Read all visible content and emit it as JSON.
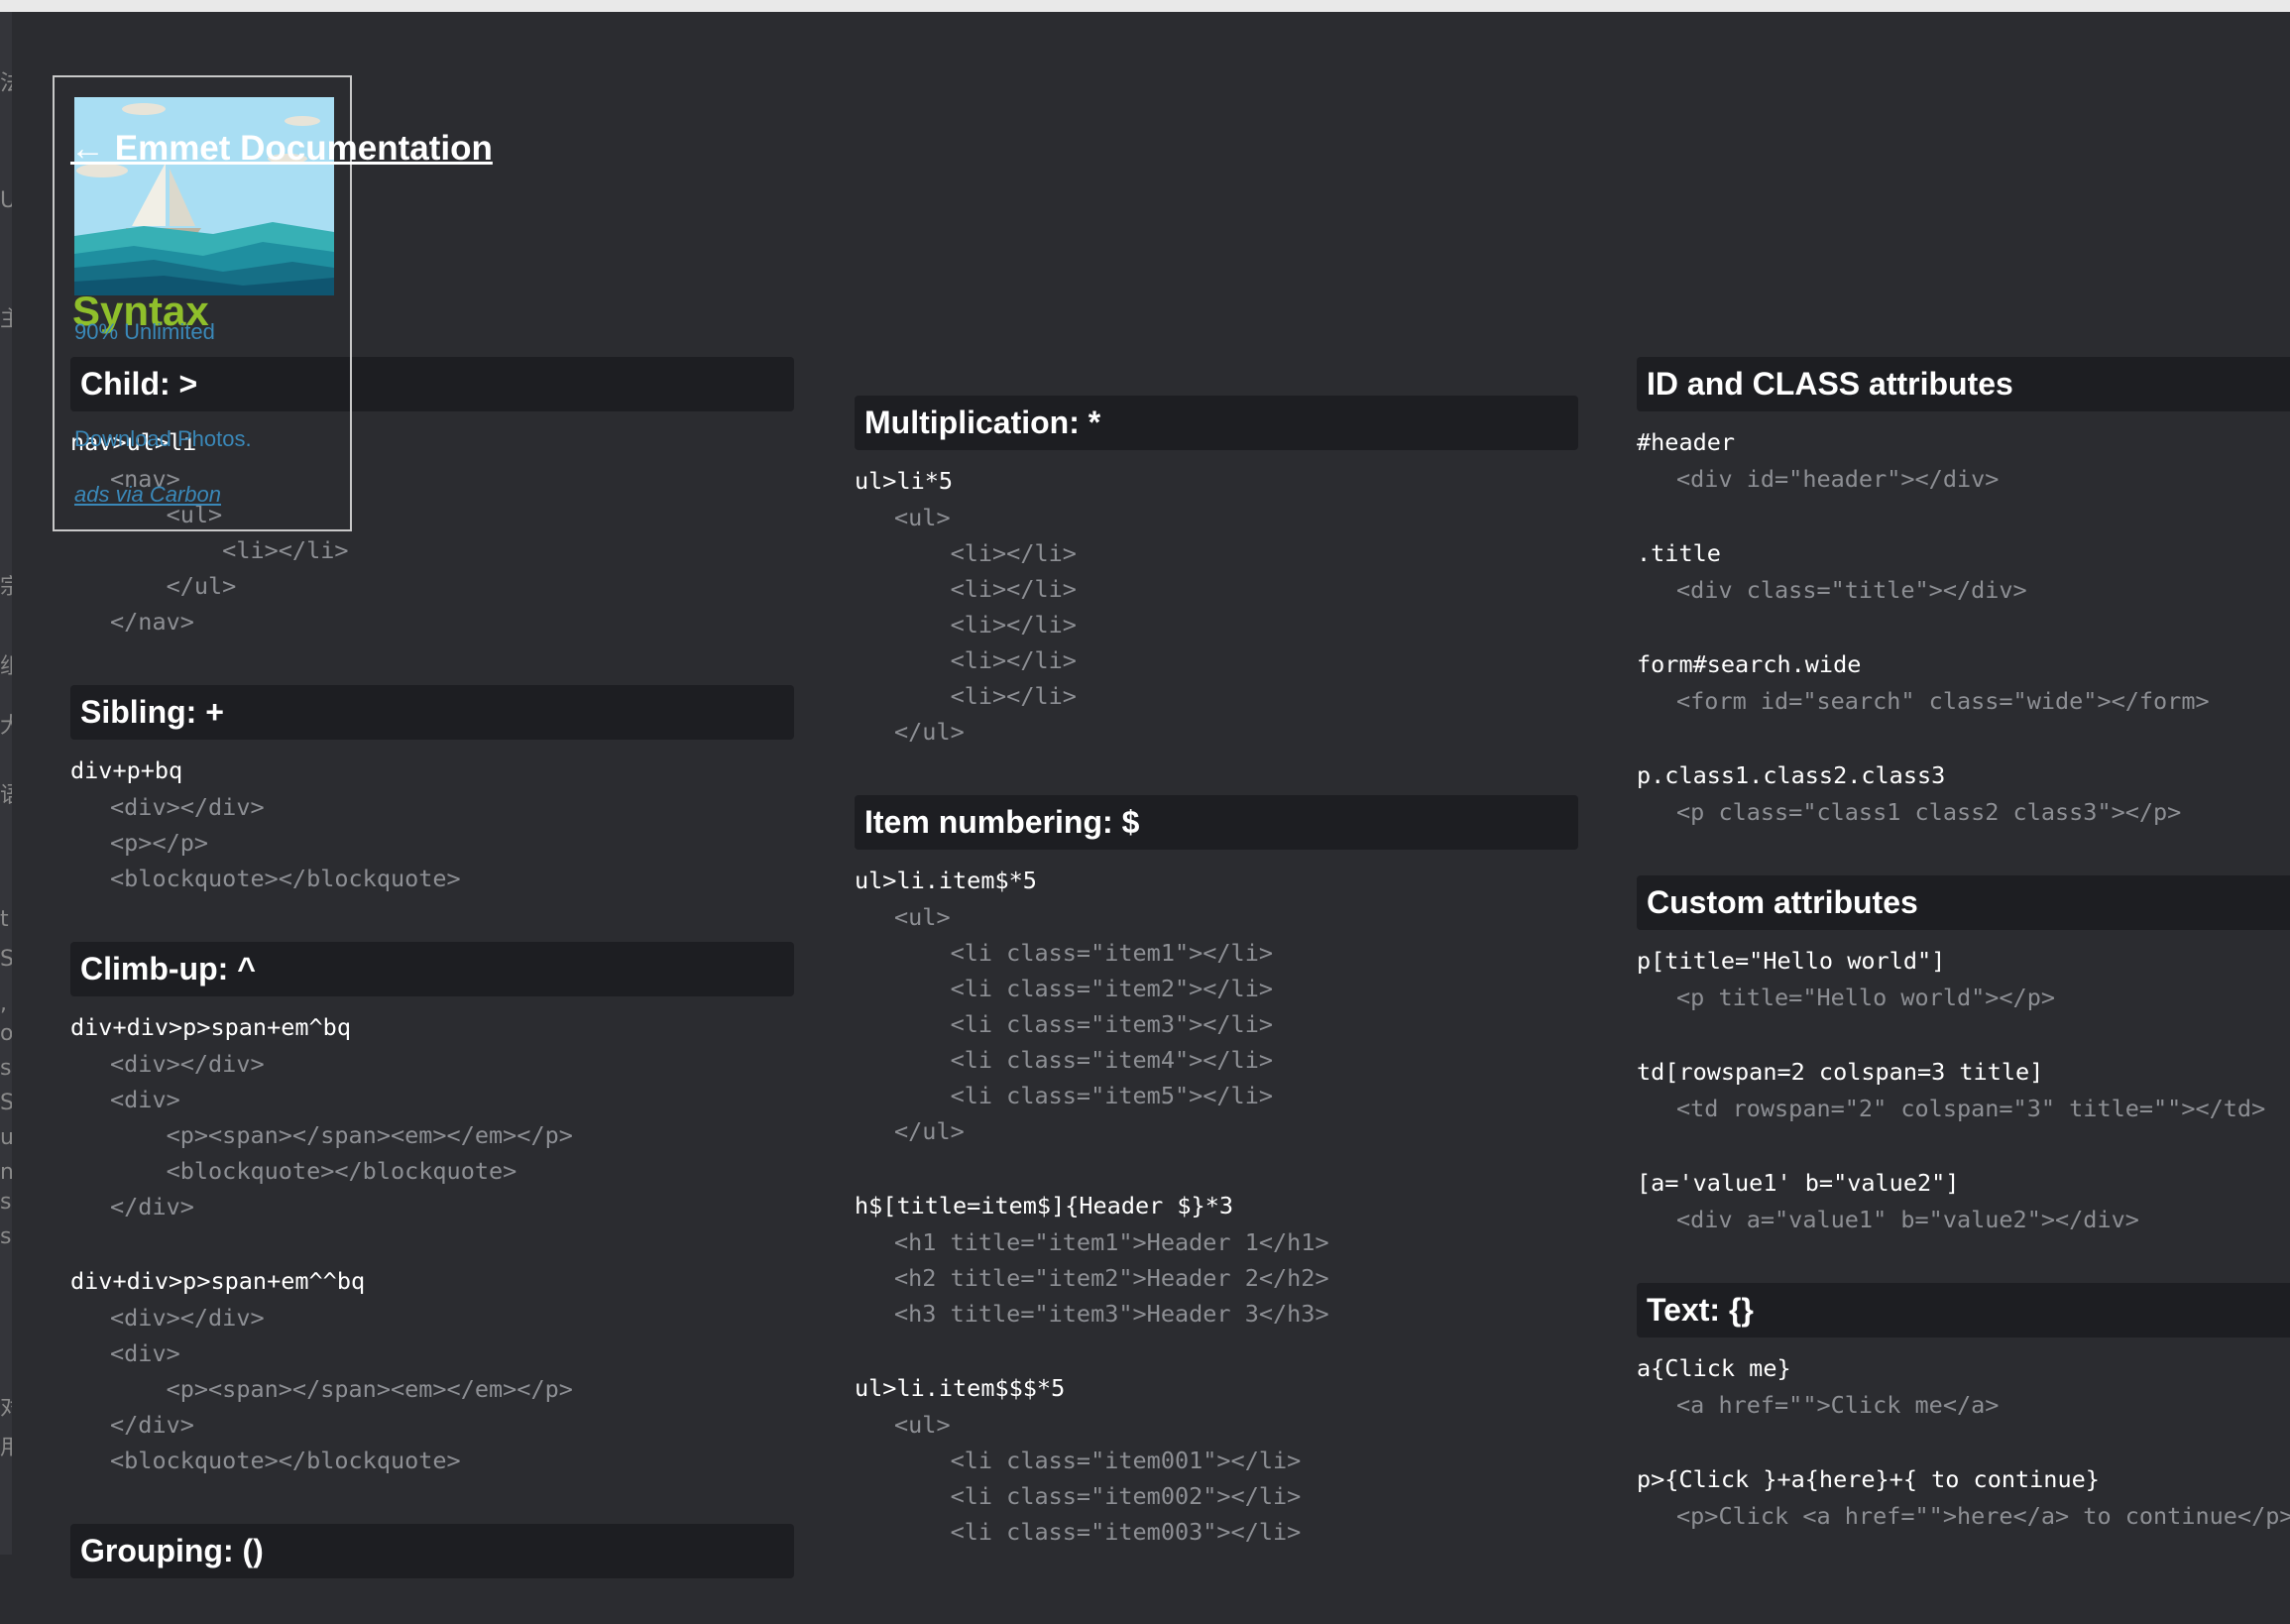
{
  "back_link": "← Emmet Documentation",
  "ad": {
    "title": "Syntax",
    "subtitle": "90% Unlimited",
    "text": "Download Photos.",
    "via": "ads via Carbon"
  },
  "left_gutter_glyphs": [
    "法",
    "U",
    "主",
    "宗",
    "组",
    "大",
    "语",
    "t",
    "S",
    ",",
    "ol",
    "s",
    "S",
    "u",
    "ng",
    "s",
    "si",
    "对",
    "用"
  ],
  "columns": [
    [
      {
        "title": "Child: >",
        "examples": [
          {
            "abbr": "nav>ul>li",
            "output": [
              "<nav>",
              "    <ul>",
              "        <li></li>",
              "    </ul>",
              "</nav>"
            ]
          }
        ]
      },
      {
        "title": "Sibling: +",
        "examples": [
          {
            "abbr": "div+p+bq",
            "output": [
              "<div></div>",
              "<p></p>",
              "<blockquote></blockquote>"
            ]
          }
        ]
      },
      {
        "title": "Climb-up: ^",
        "examples": [
          {
            "abbr": "div+div>p>span+em^bq",
            "output": [
              "<div></div>",
              "<div>",
              "    <p><span></span><em></em></p>",
              "    <blockquote></blockquote>",
              "</div>"
            ]
          },
          {
            "abbr": "div+div>p>span+em^^bq",
            "output": [
              "<div></div>",
              "<div>",
              "    <p><span></span><em></em></p>",
              "</div>",
              "<blockquote></blockquote>"
            ]
          }
        ]
      },
      {
        "title": "Grouping: ()",
        "examples": []
      }
    ],
    [
      {
        "title": "Multiplication: *",
        "examples": [
          {
            "abbr": "ul>li*5",
            "output": [
              "<ul>",
              "    <li></li>",
              "    <li></li>",
              "    <li></li>",
              "    <li></li>",
              "    <li></li>",
              "</ul>"
            ]
          }
        ]
      },
      {
        "title": "Item numbering: $",
        "examples": [
          {
            "abbr": "ul>li.item$*5",
            "output": [
              "<ul>",
              "    <li class=\"item1\"></li>",
              "    <li class=\"item2\"></li>",
              "    <li class=\"item3\"></li>",
              "    <li class=\"item4\"></li>",
              "    <li class=\"item5\"></li>",
              "</ul>"
            ]
          },
          {
            "abbr": "h$[title=item$]{Header $}*3",
            "output": [
              "<h1 title=\"item1\">Header 1</h1>",
              "<h2 title=\"item2\">Header 2</h2>",
              "<h3 title=\"item3\">Header 3</h3>"
            ]
          },
          {
            "abbr": "ul>li.item$$$*5",
            "output": [
              "<ul>",
              "    <li class=\"item001\"></li>",
              "    <li class=\"item002\"></li>",
              "    <li class=\"item003\"></li>"
            ]
          }
        ]
      }
    ],
    [
      {
        "title": "ID and CLASS attributes",
        "examples": [
          {
            "abbr": "#header",
            "output": [
              "<div id=\"header\"></div>"
            ]
          },
          {
            "abbr": ".title",
            "output": [
              "<div class=\"title\"></div>"
            ]
          },
          {
            "abbr": "form#search.wide",
            "output": [
              "<form id=\"search\" class=\"wide\"></form>"
            ]
          },
          {
            "abbr": "p.class1.class2.class3",
            "output": [
              "<p class=\"class1 class2 class3\"></p>"
            ]
          }
        ]
      },
      {
        "title": "Custom attributes",
        "examples": [
          {
            "abbr": "p[title=\"Hello world\"]",
            "output": [
              "<p title=\"Hello world\"></p>"
            ]
          },
          {
            "abbr": "td[rowspan=2 colspan=3 title]",
            "output": [
              "<td rowspan=\"2\" colspan=\"3\" title=\"\"></td>"
            ]
          },
          {
            "abbr": "[a='value1' b=\"value2\"]",
            "output": [
              "<div a=\"value1\" b=\"value2\"></div>"
            ]
          }
        ]
      },
      {
        "title": "Text: {}",
        "examples": [
          {
            "abbr": "a{Click me}",
            "output": [
              "<a href=\"\">Click me</a>"
            ]
          },
          {
            "abbr": "p>{Click }+a{here}+{ to continue}",
            "output": [
              "<p>Click <a href=\"\">here</a> to continue</p>"
            ]
          }
        ]
      }
    ]
  ]
}
